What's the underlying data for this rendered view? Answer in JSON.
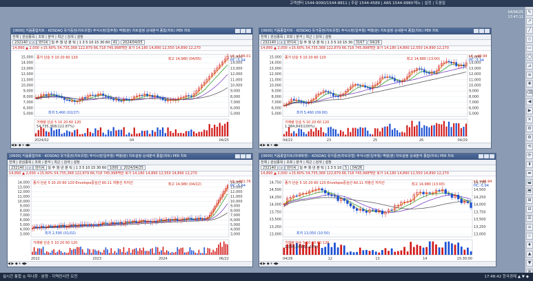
{
  "topbar": {
    "info": "고객센터 1544-9090/1544-8811 | 주문 1544-4589 | ARS 1544-9980",
    "menu": "메뉴 | 설정 | 도움말"
  },
  "datebox": {
    "date": "04/04/25",
    "time": "17:47:11"
  },
  "windows": [
    {
      "title": "[0600] 키움종합차트 - KOSDAQ 유가증권(차트유형) 주식시장(일주월) 역행(분) 차트설정 상세분석 종합(차트) PER 차트",
      "tabs": "전체 | 관심종목 | 조회 | 분석 | 최근 | 검색 | 설정",
      "code": "232140",
      "name": "와이씨",
      "period": "일 주 월 년 분 틱 | 1 3 5 10 15 30 60",
      "count": "41",
      "date": "2024/04/05",
      "quote": "14,890 ▲ 2,000 +15.60%  54,735,368  122,879 66,718  745,998백만 호가  14,180  14,890  12,550  14,890  12,270",
      "legend": "종가 단순 5 10 20 60 120",
      "high_label": "최고 14,980 (04/05)",
      "low_label": "최저 5,460 (02/27)",
      "rlabels": [
        "LC:+136.01",
        "HC:-5.94"
      ],
      "yticks": [
        "15,000",
        "14,000",
        "13,000",
        "12,000",
        "11,000",
        "10,000",
        "9,000",
        "8,000",
        "7,000",
        "6,000",
        "5,000"
      ],
      "xticks": [
        "2024/02",
        "04",
        "04/25"
      ],
      "vol_legend": "거래량 단순 5 10 20 60 120",
      "vol_max": "54,735,368(122.87%)"
    },
    {
      "title": "[0600] 키움종합차트 - KOSDAQ 유가증권(차트유형) 주식시장(일주월) 역행(분) 차트설정 상세분석 종합(차트) PER 차트",
      "tabs": "전체 | 관심종목 | 조회 | 분석 | 최근 | 검색 | 설정",
      "code": "232140",
      "name": "와이씨",
      "period": "일 주 월 년 분 틱 | 1 3 5 10 15 30",
      "count": "3167",
      "date": "04/26",
      "quote": "14,890 ▲ 2,000 +15.60%  54,735,368  122,879 66,718  745,998백만 호가  14,180  14,890  12,550  14,890  12,270",
      "legend": "종가 단순 5 10 20 60 120",
      "high_label": "최고 14,980 (13:00)",
      "low_label": "최저 5,460 (09:00)",
      "rlabels": [
        "LC:+40.94",
        "HC:-5.94"
      ],
      "yticks": [
        "15,000",
        "14,000",
        "13,000",
        "12,000",
        "11,000",
        "10,000",
        "9,000",
        "8,000",
        "7,000",
        "6,000",
        "5,000"
      ],
      "xticks": [
        "04/22",
        "23",
        "25",
        "26",
        "04/29"
      ],
      "vol_legend": "거래량 단순 5 10 20 60 120",
      "vol_max": "1,384,843(100%)"
    },
    {
      "title": "[0600] 키움종합차트 - KOSDAQ 유가증권(차트유형) 주식시장(일주월) 역행(분) 차트설정 상세분석 종합(차트) PER 차트",
      "tabs": "전체 | 관심종목 | 조회 | 분석 | 최근 | 검색 | 설정",
      "code": "232140",
      "name": "와이씨",
      "period": "일 주 월 년 분 틱 | 1 3 5 10 15 30 60",
      "count": "1000",
      "date": "2024/04/25",
      "quote": "14,890 ▲ 2,000 +15.60%  54,735,368  122,879 66,718  745,998백만 호가  14,180  14,890  12,550  14,890  12,270",
      "legend": "종가 단순 5 10 20 60 120  Envelope중심선 60.11 저항선 지지선",
      "high_label": "최고 14,980 (04/22)",
      "low_label": "최저 2,590 (01/02)",
      "rlabels": [
        "LC:+421.76",
        "HC:-5.94"
      ],
      "yticks": [
        "14,000",
        "13,000",
        "12,000",
        "11,000",
        "10,000",
        "9,000",
        "8,000",
        "7,000",
        "6,000",
        "5,000",
        "4,000",
        "3,000"
      ],
      "xticks": [
        "2022",
        "2023",
        "2024",
        "06/22"
      ],
      "vol_legend": "거래량 단순 5 10 20 60 120",
      "vol_max": ""
    },
    {
      "title": "[0600] 키움종합차트(미래에셋) - KOSDAQ 유가증권(차트유형) 주식시장(일주월) 역행(분) 차트설정 상세분석 종합(차트) PER 차트",
      "tabs": "전체 | 관심종목 | 조회 | 분석 | 최근 | 검색 | 설정",
      "code": "232140",
      "name": "와이씨",
      "period": "일 주 월 년 분 틱 | 1 3 5 10",
      "count": "5",
      "date": "04/26",
      "quote": "14,890 ▲ 2,000 +15.60%  54,735,368  122,879 66,718  745,998백만 호가  14,180  14,890  12,550  14,890  12,270",
      "legend": "종가 단순 5 10 20 60 120  Envelope중심선 60.11 저항선 지지선",
      "high_label": "최고 14,980 (13:00)",
      "low_label": "최저 13,050 (10:50)",
      "rlabels": [
        "LC:+46.94",
        "HC:-5.94"
      ],
      "yticks": [
        "14,750",
        "14,500",
        "14,250",
        "14,000",
        "13,750",
        "13,500",
        "13,250",
        "13,000"
      ],
      "xticks": [
        "04/26",
        "12",
        "13",
        "14",
        "15:30:00"
      ],
      "vol_legend": "거래량 단순 5 10 20 60 120",
      "vol_max": "1,384,843(51.28%)"
    }
  ],
  "statusbar": {
    "left": "실시간 통합 ◎ 미니창 · 분양 · 지역진사전 오전",
    "right": "17:48:42  한국경제  ▲ ▼ ◆"
  },
  "side_icons": [
    "✎",
    "↗",
    "╱",
    "◇",
    "▭",
    "◯",
    "⊿",
    "≡",
    "✚",
    "⌫",
    "◀",
    "▶",
    "✕",
    "⚙",
    "⚙",
    "⟲",
    "⟳",
    "⬍",
    "⬌",
    "⬓",
    "⬒",
    "⊞",
    "⊟",
    "☰",
    "⌂",
    "☆",
    "♦",
    "▲",
    "▼",
    "⌘"
  ],
  "colors": {
    "up": "#d21b1b",
    "down": "#1b4fd2",
    "ma5": "#e0a000",
    "ma10": "#2a9d2a",
    "ma20": "#7b3fbf",
    "ma60": "#5d5d5d",
    "ma120": "#999999"
  }
}
